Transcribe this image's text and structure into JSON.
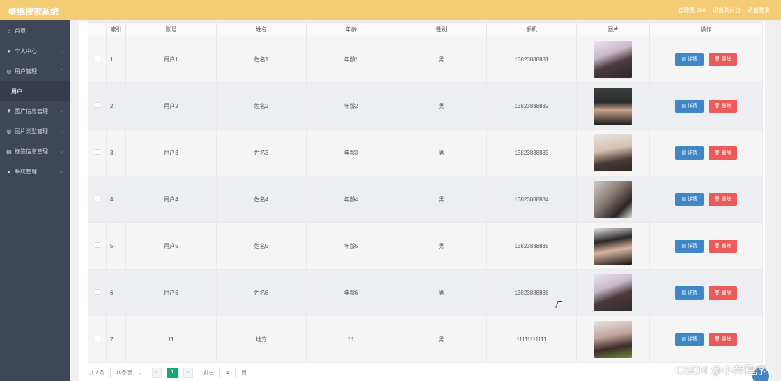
{
  "header": {
    "brand": "壁纸搜索系统",
    "links": [
      "管理员 abo",
      "退出到前台",
      "退出登录"
    ]
  },
  "sidebar": {
    "items": [
      {
        "icon": "home-icon",
        "glyph": "⌂",
        "label": "首页",
        "chevron": false
      },
      {
        "icon": "user-icon",
        "glyph": "●",
        "label": "个人中心",
        "chevron": true
      },
      {
        "icon": "users-manage-icon",
        "glyph": "◎",
        "label": "用户管理",
        "chevron": true,
        "expanded": true
      },
      {
        "icon": "image-info-icon",
        "glyph": "▼",
        "label": "图片信息管理",
        "chevron": true
      },
      {
        "icon": "image-type-icon",
        "glyph": "◍",
        "label": "图片类型管理",
        "chevron": true
      },
      {
        "icon": "tag-icon",
        "glyph": "▤",
        "label": "标签信息管理",
        "chevron": true
      },
      {
        "icon": "system-icon",
        "glyph": "●",
        "label": "系统管理",
        "chevron": true
      }
    ],
    "subitem": "用户"
  },
  "table": {
    "columns": [
      "索引",
      "账号",
      "姓名",
      "年龄",
      "性别",
      "手机",
      "图片",
      "操作"
    ],
    "rows": [
      {
        "index": "1",
        "account": "用户1",
        "name": "姓名1",
        "age": "年龄1",
        "gender": "男",
        "phone": "13823888881"
      },
      {
        "index": "2",
        "account": "用户2",
        "name": "姓名2",
        "age": "年龄2",
        "gender": "男",
        "phone": "13823888882"
      },
      {
        "index": "3",
        "account": "用户3",
        "name": "姓名3",
        "age": "年龄3",
        "gender": "男",
        "phone": "13823888883"
      },
      {
        "index": "4",
        "account": "用户4",
        "name": "姓名4",
        "age": "年龄4",
        "gender": "男",
        "phone": "13823888884"
      },
      {
        "index": "5",
        "account": "用户5",
        "name": "姓名5",
        "age": "年龄5",
        "gender": "男",
        "phone": "13823888885"
      },
      {
        "index": "6",
        "account": "用户6",
        "name": "姓名6",
        "age": "年龄6",
        "gender": "男",
        "phone": "13823888886"
      },
      {
        "index": "7",
        "account": "11",
        "name": "地方",
        "age": "11",
        "gender": "男",
        "phone": "11111111111"
      }
    ],
    "detail_label": "详情",
    "delete_label": "删除"
  },
  "pager": {
    "total": "共 7 条",
    "page_size": "10条/页",
    "prev": "<",
    "current": "1",
    "next": ">",
    "goto_label": "前往",
    "goto_value": "1",
    "page_suffix": "页"
  },
  "watermark": "CSDN @小奔程序",
  "colors": {
    "header": "#f3cc73",
    "sidebar": "#3f4656",
    "detail": "#3f87c6",
    "delete": "#ec5a5a",
    "page_active": "#16a874"
  }
}
